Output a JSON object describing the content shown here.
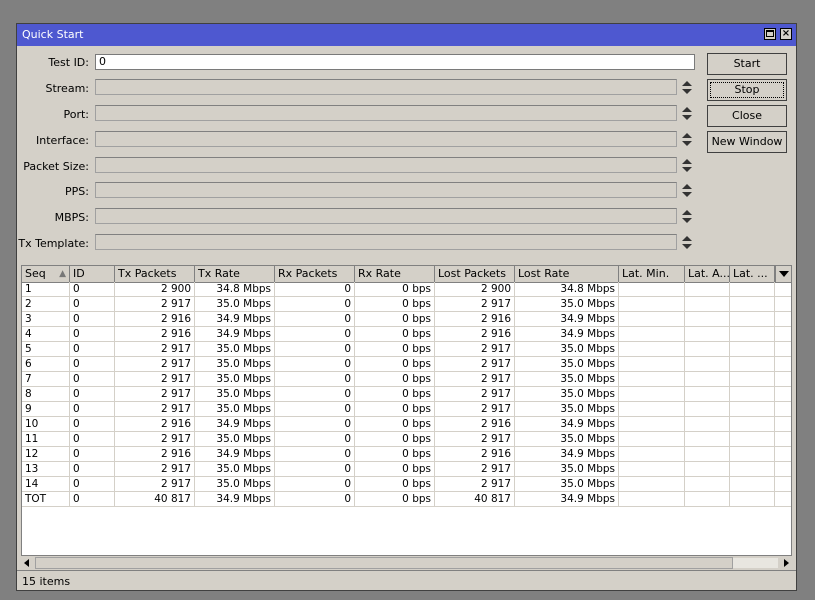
{
  "window": {
    "title": "Quick Start"
  },
  "form": {
    "test_id": {
      "label": "Test ID:",
      "value": "0"
    },
    "stream": {
      "label": "Stream:"
    },
    "port": {
      "label": "Port:"
    },
    "interface": {
      "label": "Interface:"
    },
    "packet_size": {
      "label": "Packet Size:"
    },
    "pps": {
      "label": "PPS:"
    },
    "mbps": {
      "label": "MBPS:"
    },
    "tx_template": {
      "label": "Tx Template:"
    }
  },
  "buttons": {
    "start": "Start",
    "stop": "Stop",
    "close": "Close",
    "new_window": "New Window"
  },
  "table": {
    "columns": [
      "Seq",
      "ID",
      "Tx Packets",
      "Tx Rate",
      "Rx Packets",
      "Rx Rate",
      "Lost Packets",
      "Lost Rate",
      "Lat. Min.",
      "Lat. A...",
      "Lat. ..."
    ],
    "rows": [
      [
        "1",
        "0",
        "2 900",
        "34.8 Mbps",
        "0",
        "0 bps",
        "2 900",
        "34.8 Mbps",
        "",
        "",
        ""
      ],
      [
        "2",
        "0",
        "2 917",
        "35.0 Mbps",
        "0",
        "0 bps",
        "2 917",
        "35.0 Mbps",
        "",
        "",
        ""
      ],
      [
        "3",
        "0",
        "2 916",
        "34.9 Mbps",
        "0",
        "0 bps",
        "2 916",
        "34.9 Mbps",
        "",
        "",
        ""
      ],
      [
        "4",
        "0",
        "2 916",
        "34.9 Mbps",
        "0",
        "0 bps",
        "2 916",
        "34.9 Mbps",
        "",
        "",
        ""
      ],
      [
        "5",
        "0",
        "2 917",
        "35.0 Mbps",
        "0",
        "0 bps",
        "2 917",
        "35.0 Mbps",
        "",
        "",
        ""
      ],
      [
        "6",
        "0",
        "2 917",
        "35.0 Mbps",
        "0",
        "0 bps",
        "2 917",
        "35.0 Mbps",
        "",
        "",
        ""
      ],
      [
        "7",
        "0",
        "2 917",
        "35.0 Mbps",
        "0",
        "0 bps",
        "2 917",
        "35.0 Mbps",
        "",
        "",
        ""
      ],
      [
        "8",
        "0",
        "2 917",
        "35.0 Mbps",
        "0",
        "0 bps",
        "2 917",
        "35.0 Mbps",
        "",
        "",
        ""
      ],
      [
        "9",
        "0",
        "2 917",
        "35.0 Mbps",
        "0",
        "0 bps",
        "2 917",
        "35.0 Mbps",
        "",
        "",
        ""
      ],
      [
        "10",
        "0",
        "2 916",
        "34.9 Mbps",
        "0",
        "0 bps",
        "2 916",
        "34.9 Mbps",
        "",
        "",
        ""
      ],
      [
        "11",
        "0",
        "2 917",
        "35.0 Mbps",
        "0",
        "0 bps",
        "2 917",
        "35.0 Mbps",
        "",
        "",
        ""
      ],
      [
        "12",
        "0",
        "2 916",
        "34.9 Mbps",
        "0",
        "0 bps",
        "2 916",
        "34.9 Mbps",
        "",
        "",
        ""
      ],
      [
        "13",
        "0",
        "2 917",
        "35.0 Mbps",
        "0",
        "0 bps",
        "2 917",
        "35.0 Mbps",
        "",
        "",
        ""
      ],
      [
        "14",
        "0",
        "2 917",
        "35.0 Mbps",
        "0",
        "0 bps",
        "2 917",
        "35.0 Mbps",
        "",
        "",
        ""
      ],
      [
        "TOT",
        "0",
        "40 817",
        "34.9 Mbps",
        "0",
        "0 bps",
        "40 817",
        "34.9 Mbps",
        "",
        "",
        ""
      ]
    ]
  },
  "status": {
    "items": "15 items"
  }
}
